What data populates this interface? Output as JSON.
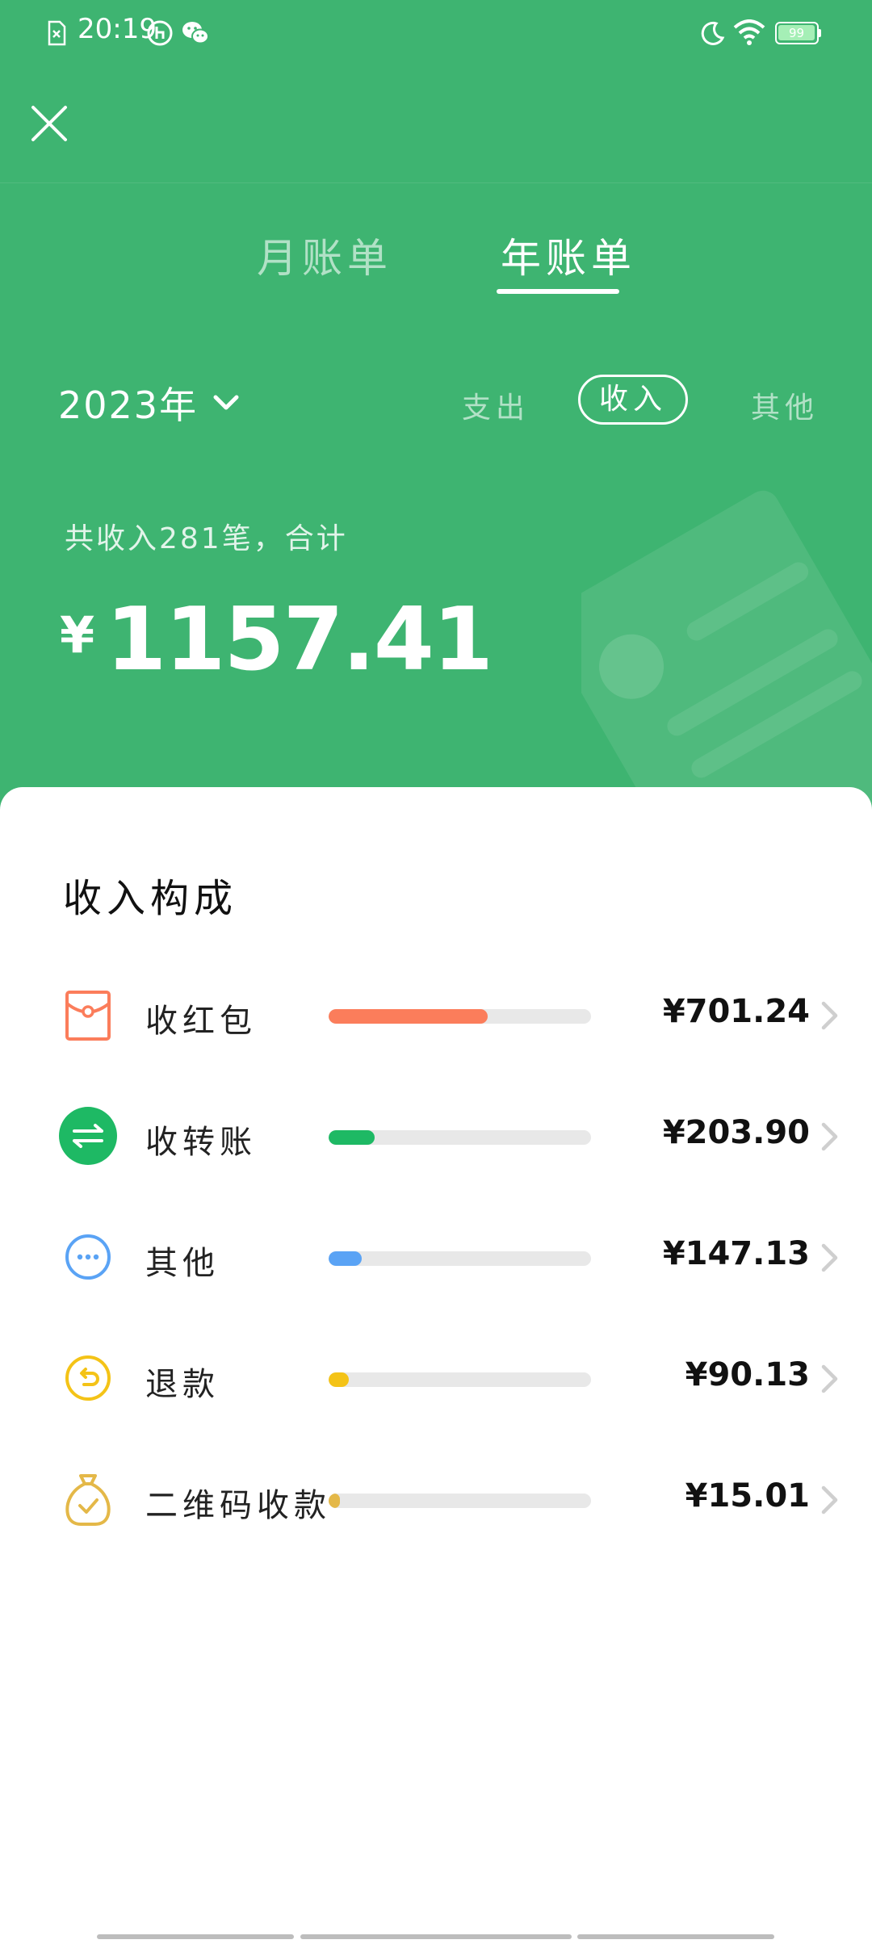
{
  "status_bar": {
    "time": "20:19",
    "battery": "99"
  },
  "tabs": [
    {
      "label": "月账单",
      "active": false
    },
    {
      "label": "年账单",
      "active": true
    }
  ],
  "filter": {
    "year": "2023年",
    "segments": [
      {
        "label": "支出",
        "active": false
      },
      {
        "label": "收入",
        "active": true
      },
      {
        "label": "其他",
        "active": false
      }
    ]
  },
  "summary": {
    "text": "共收入281笔，合计",
    "currency": "¥",
    "total": "1157.41"
  },
  "breakdown": {
    "title": "收入构成",
    "items": [
      {
        "label": "收红包",
        "value": "¥701.24",
        "share": 0.606,
        "color": "#fb7d5b",
        "icon": "red-envelope-icon"
      },
      {
        "label": "收转账",
        "value": "¥203.90",
        "share": 0.176,
        "color": "#1eb964",
        "icon": "transfer-icon"
      },
      {
        "label": "其他",
        "value": "¥147.13",
        "share": 0.127,
        "color": "#5aa3f5",
        "icon": "more-icon"
      },
      {
        "label": "退款",
        "value": "¥90.13",
        "share": 0.078,
        "color": "#f4c317",
        "icon": "refund-icon"
      },
      {
        "label": "二维码收款",
        "value": "¥15.01",
        "share": 0.013,
        "color": "#e4b848",
        "icon": "money-bag-icon"
      }
    ]
  }
}
